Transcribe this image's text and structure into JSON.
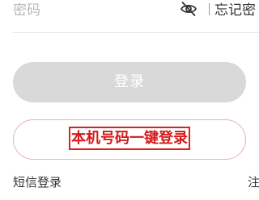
{
  "password_row": {
    "placeholder": "密码",
    "visibility_icon": "eye-off-icon",
    "forgot_label": "忘记密"
  },
  "login_button": {
    "label": "登录",
    "color": "#d9d9d9"
  },
  "one_click_button": {
    "label": "本机号码一键登录",
    "highlight_color": "#e02020"
  },
  "footer": {
    "sms_login_label": "短信登录",
    "register_label": "注"
  }
}
